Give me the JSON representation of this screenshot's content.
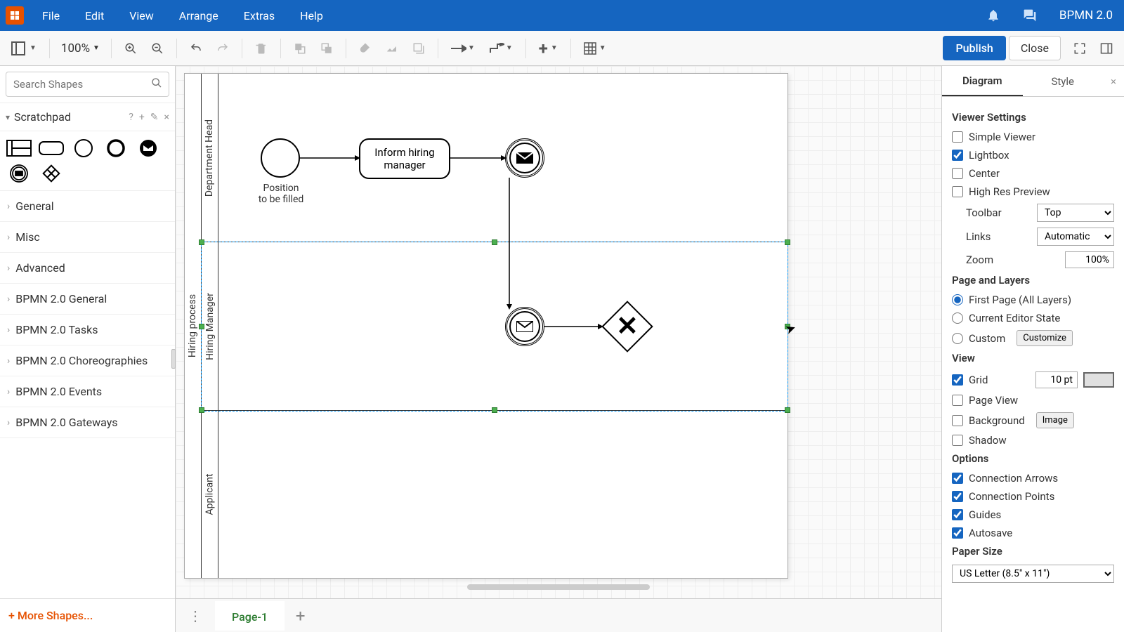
{
  "app": {
    "name": "BPMN 2.0"
  },
  "menu": {
    "file": "File",
    "edit": "Edit",
    "view": "View",
    "arrange": "Arrange",
    "extras": "Extras",
    "help": "Help"
  },
  "toolbar": {
    "zoom": "100%",
    "publish": "Publish",
    "close": "Close"
  },
  "sidebar": {
    "search_placeholder": "Search Shapes",
    "scratchpad": "Scratchpad",
    "categories": [
      "General",
      "Misc",
      "Advanced",
      "BPMN 2.0 General",
      "BPMN 2.0 Tasks",
      "BPMN 2.0 Choreographies",
      "BPMN 2.0 Events",
      "BPMN 2.0 Gateways"
    ],
    "more": "More Shapes..."
  },
  "diagram": {
    "pool": "Hiring process",
    "lanes": [
      "Department Head",
      "Hiring Manager",
      "Applicant"
    ],
    "start_label": "Position\nto be filled",
    "task1": "Inform hiring manager"
  },
  "tabs": {
    "page1": "Page-1"
  },
  "right": {
    "tabs": {
      "diagram": "Diagram",
      "style": "Style"
    },
    "viewer_settings": "Viewer Settings",
    "simple_viewer": "Simple Viewer",
    "lightbox": "Lightbox",
    "center": "Center",
    "high_res": "High Res Preview",
    "toolbar_label": "Toolbar",
    "toolbar_value": "Top",
    "links_label": "Links",
    "links_value": "Automatic",
    "zoom_label": "Zoom",
    "zoom_value": "100%",
    "page_layers": "Page and Layers",
    "first_page": "First Page (All Layers)",
    "current_editor": "Current Editor State",
    "custom": "Custom",
    "customize": "Customize",
    "view": "View",
    "grid": "Grid",
    "grid_value": "10 pt",
    "page_view": "Page View",
    "background": "Background",
    "image_btn": "Image",
    "shadow": "Shadow",
    "options": "Options",
    "conn_arrows": "Connection Arrows",
    "conn_points": "Connection Points",
    "guides": "Guides",
    "autosave": "Autosave",
    "paper_size": "Paper Size",
    "paper_value": "US Letter (8.5\" x 11\")"
  }
}
